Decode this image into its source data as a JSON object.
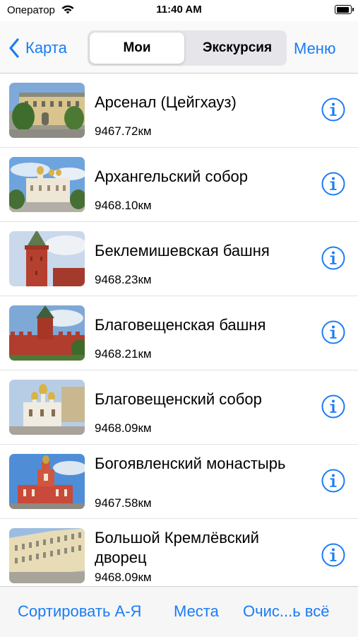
{
  "status_bar": {
    "carrier": "Оператор",
    "time": "11:40 AM",
    "battery_level": 0.9
  },
  "nav": {
    "back_label": "Карта",
    "segments": [
      "Мои",
      "Экскурсия"
    ],
    "selected_segment": "Мои",
    "menu_label": "Меню"
  },
  "list": [
    {
      "title": "Арсенал (Цейгхауз)",
      "distance": "9467.72км",
      "thumb_icon": "arsenal-photo"
    },
    {
      "title": "Архангельский собор",
      "distance": "9468.10км",
      "thumb_icon": "cathedral-photo"
    },
    {
      "title": "Беклемишевская башня",
      "distance": "9468.23км",
      "thumb_icon": "tower-photo"
    },
    {
      "title": "Благовещенская башня",
      "distance": "9468.21км",
      "thumb_icon": "tower-photo"
    },
    {
      "title": "Благовещенский собор",
      "distance": "9468.09км",
      "thumb_icon": "cathedral-photo"
    },
    {
      "title": "Богоявленский монастырь",
      "distance": "9467.58км",
      "thumb_icon": "monastery-photo"
    },
    {
      "title": "Большой Кремлёвский дворец",
      "distance": "9468.09км",
      "thumb_icon": "palace-photo"
    }
  ],
  "toolbar": {
    "sort_label": "Сортировать А-Я",
    "places_label": "Места",
    "clear_label": "Очис...ь всё"
  },
  "colors": {
    "accent": "#1a7cf5",
    "kremlin_red": "#b5402f"
  }
}
